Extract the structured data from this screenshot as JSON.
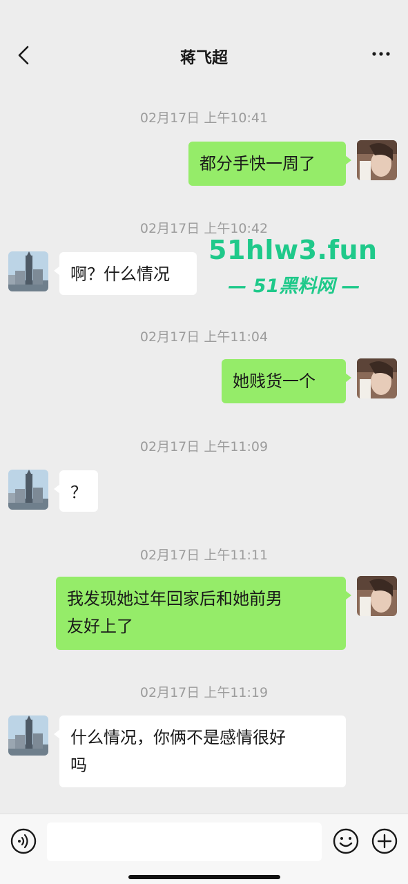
{
  "header": {
    "title": "蒋飞超",
    "back_icon": "chevron-left-icon",
    "more_icon": "more-dots-icon"
  },
  "messages": [
    {
      "timestamp": "02月17日 上午10:41",
      "sender": "me",
      "text": "都分手快一周了"
    },
    {
      "timestamp": "02月17日 上午10:42",
      "sender": "other",
      "text": "啊？什么情况"
    },
    {
      "timestamp": "02月17日 上午11:04",
      "sender": "me",
      "text": "她贱货一个"
    },
    {
      "timestamp": "02月17日 上午11:09",
      "sender": "other",
      "text": "？"
    },
    {
      "timestamp": "02月17日 上午11:11",
      "sender": "me",
      "lines": [
        "我发现她过年回家后和她前男",
        "友好上了"
      ]
    },
    {
      "timestamp": "02月17日 上午11:19",
      "sender": "other",
      "lines": [
        "什么情况，你俩不是感情很好",
        "吗"
      ]
    }
  ],
  "watermark": {
    "domain": "51hlw3.fun",
    "site": "— 51黑料网 —"
  },
  "input_bar": {
    "voice_icon": "voice-icon",
    "input_value": "",
    "emoji_icon": "emoji-icon",
    "plus_icon": "plus-icon"
  },
  "colors": {
    "background": "#ededed",
    "bubble_me": "#95ec69",
    "bubble_other": "#ffffff",
    "timestamp": "#9c9c9c",
    "watermark": "#1fc98a"
  }
}
